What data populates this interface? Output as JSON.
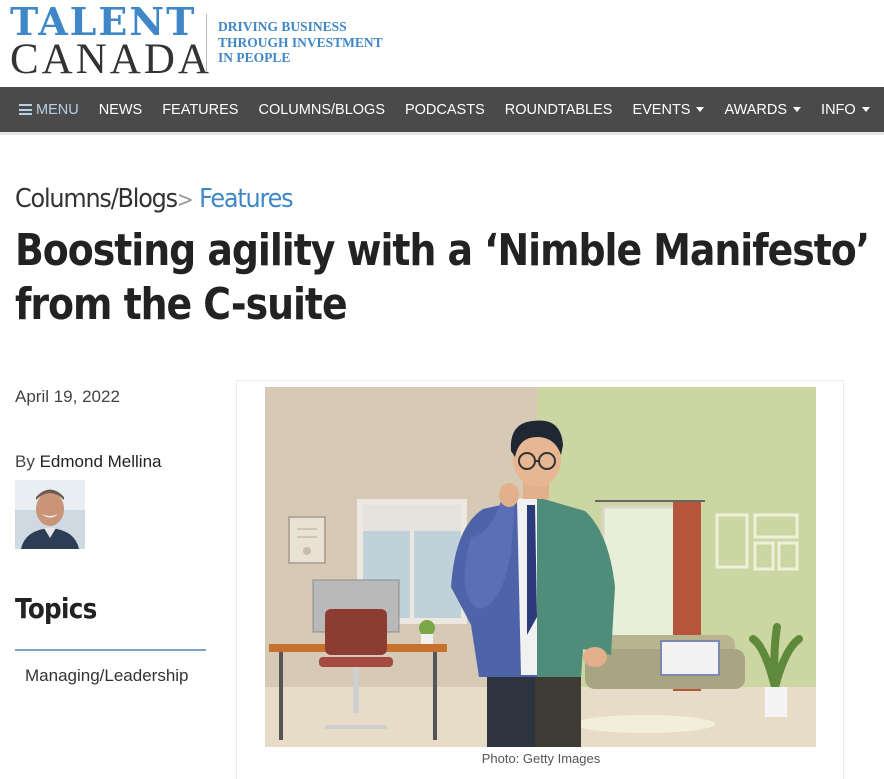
{
  "brand": {
    "logo_top": "TALENT",
    "logo_bottom": "CANADA",
    "tagline_1": "DRIVING BUSINESS",
    "tagline_2": "THROUGH INVESTMENT",
    "tagline_3": "IN PEOPLE",
    "accent": "#3f87c7"
  },
  "nav": {
    "menu_label": "MENU",
    "items": [
      {
        "label": "NEWS"
      },
      {
        "label": "FEATURES"
      },
      {
        "label": "COLUMNS/BLOGS"
      },
      {
        "label": "PODCASTS"
      },
      {
        "label": "ROUNDTABLES"
      },
      {
        "label": "EVENTS",
        "dropdown": true
      },
      {
        "label": "AWARDS",
        "dropdown": true
      },
      {
        "label": "INFO",
        "dropdown": true
      }
    ],
    "background": "#4a4a4a"
  },
  "article": {
    "breadcrumb_parent": "Columns/Blogs",
    "breadcrumb_sep": ">",
    "breadcrumb_current": "Features",
    "title": "Boosting agility with a ‘Nimble Manifesto’ from the C-suite",
    "date": "April 19, 2022",
    "by_prefix": "By",
    "author": "Edmond Mellina",
    "image_caption": "Photo: Getty Images"
  },
  "topics": {
    "heading": "Topics",
    "items": [
      "Managing/Leadership"
    ]
  }
}
